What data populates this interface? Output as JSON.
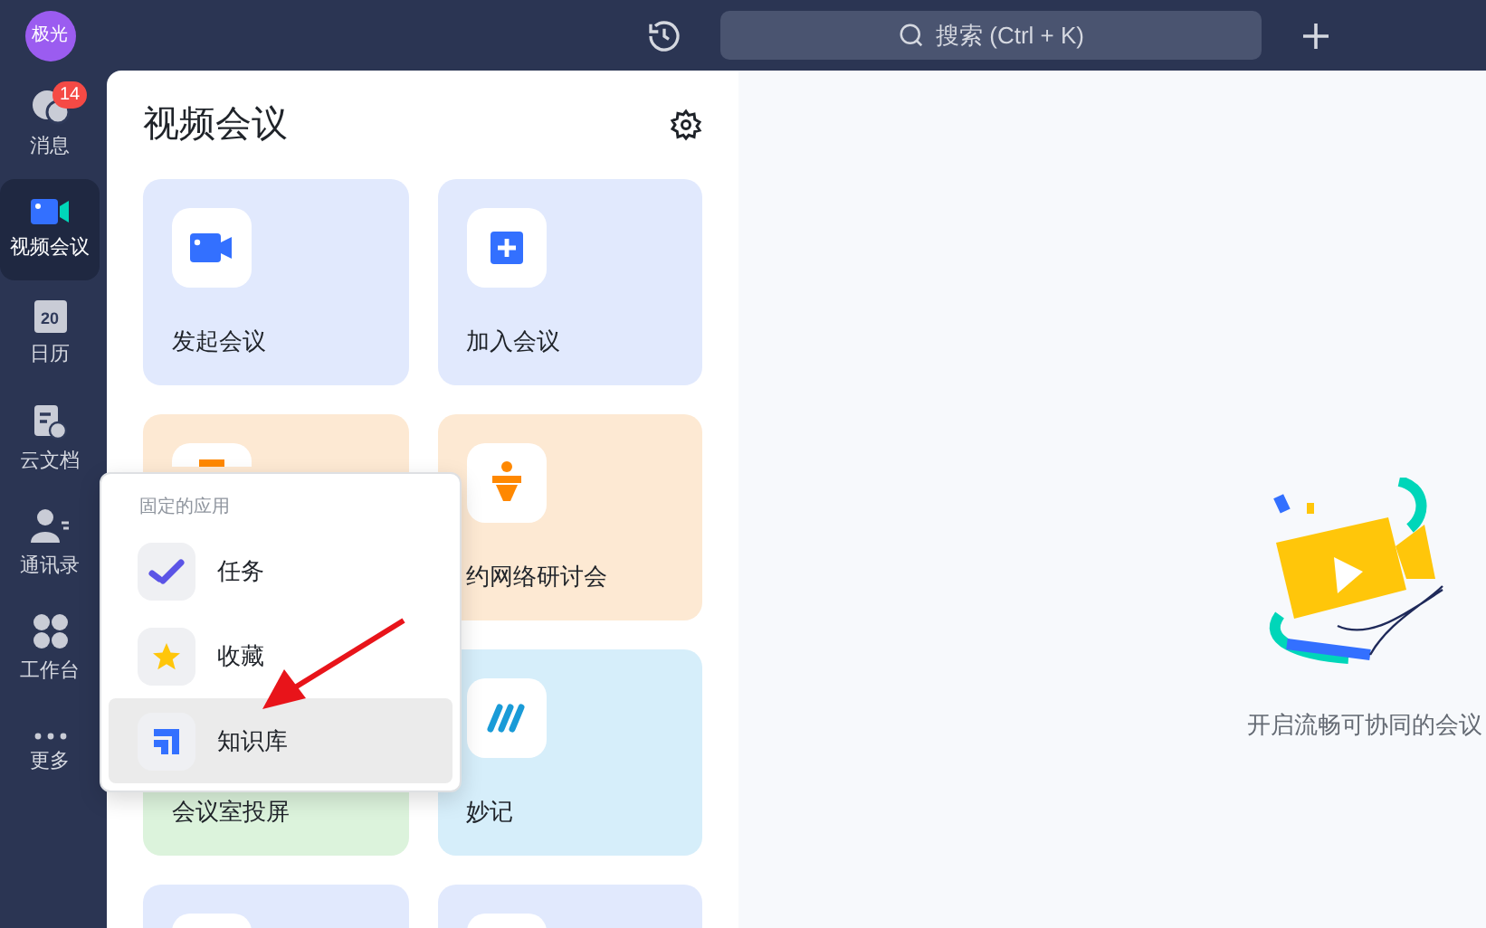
{
  "avatar": {
    "label": "极光"
  },
  "search": {
    "placeholder": "搜索 (Ctrl + K)"
  },
  "sidebar": {
    "items": [
      {
        "kind": "chat",
        "label": "消息",
        "badge": "14",
        "selected": false
      },
      {
        "kind": "video",
        "label": "视频会议",
        "selected": true
      },
      {
        "kind": "calendar",
        "label": "日历",
        "icon_text": "20",
        "selected": false
      },
      {
        "kind": "docs",
        "label": "云文档",
        "selected": false
      },
      {
        "kind": "contacts",
        "label": "通讯录",
        "selected": false
      },
      {
        "kind": "apps",
        "label": "工作台",
        "selected": false
      },
      {
        "kind": "more",
        "label": "更多",
        "selected": false
      }
    ]
  },
  "panel": {
    "title": "视频会议",
    "cards": [
      {
        "kind": "start",
        "label": "发起会议",
        "color": "#e1e9fd"
      },
      {
        "kind": "join",
        "label": "加入会议",
        "color": "#e1e9fd"
      },
      {
        "kind": "webinar_a",
        "color": "#fde9d3"
      },
      {
        "kind": "webinar",
        "label": "约网络研讨会",
        "color": "#fde9d3"
      },
      {
        "kind": "share",
        "label": "会议室投屏",
        "color": "#dcf3dc"
      },
      {
        "kind": "notes",
        "label": "妙记",
        "color": "#d6eefa"
      },
      {
        "kind": "blank",
        "color": "#e1e9fd"
      },
      {
        "kind": "blank",
        "color": "#e1e9fd"
      }
    ]
  },
  "popup": {
    "heading": "固定的应用",
    "items": [
      {
        "kind": "task",
        "label": "任务",
        "selected": false
      },
      {
        "kind": "star",
        "label": "收藏",
        "selected": false
      },
      {
        "kind": "wiki",
        "label": "知识库",
        "selected": true
      }
    ]
  },
  "empty_state": {
    "text": "开启流畅可协同的会议"
  }
}
